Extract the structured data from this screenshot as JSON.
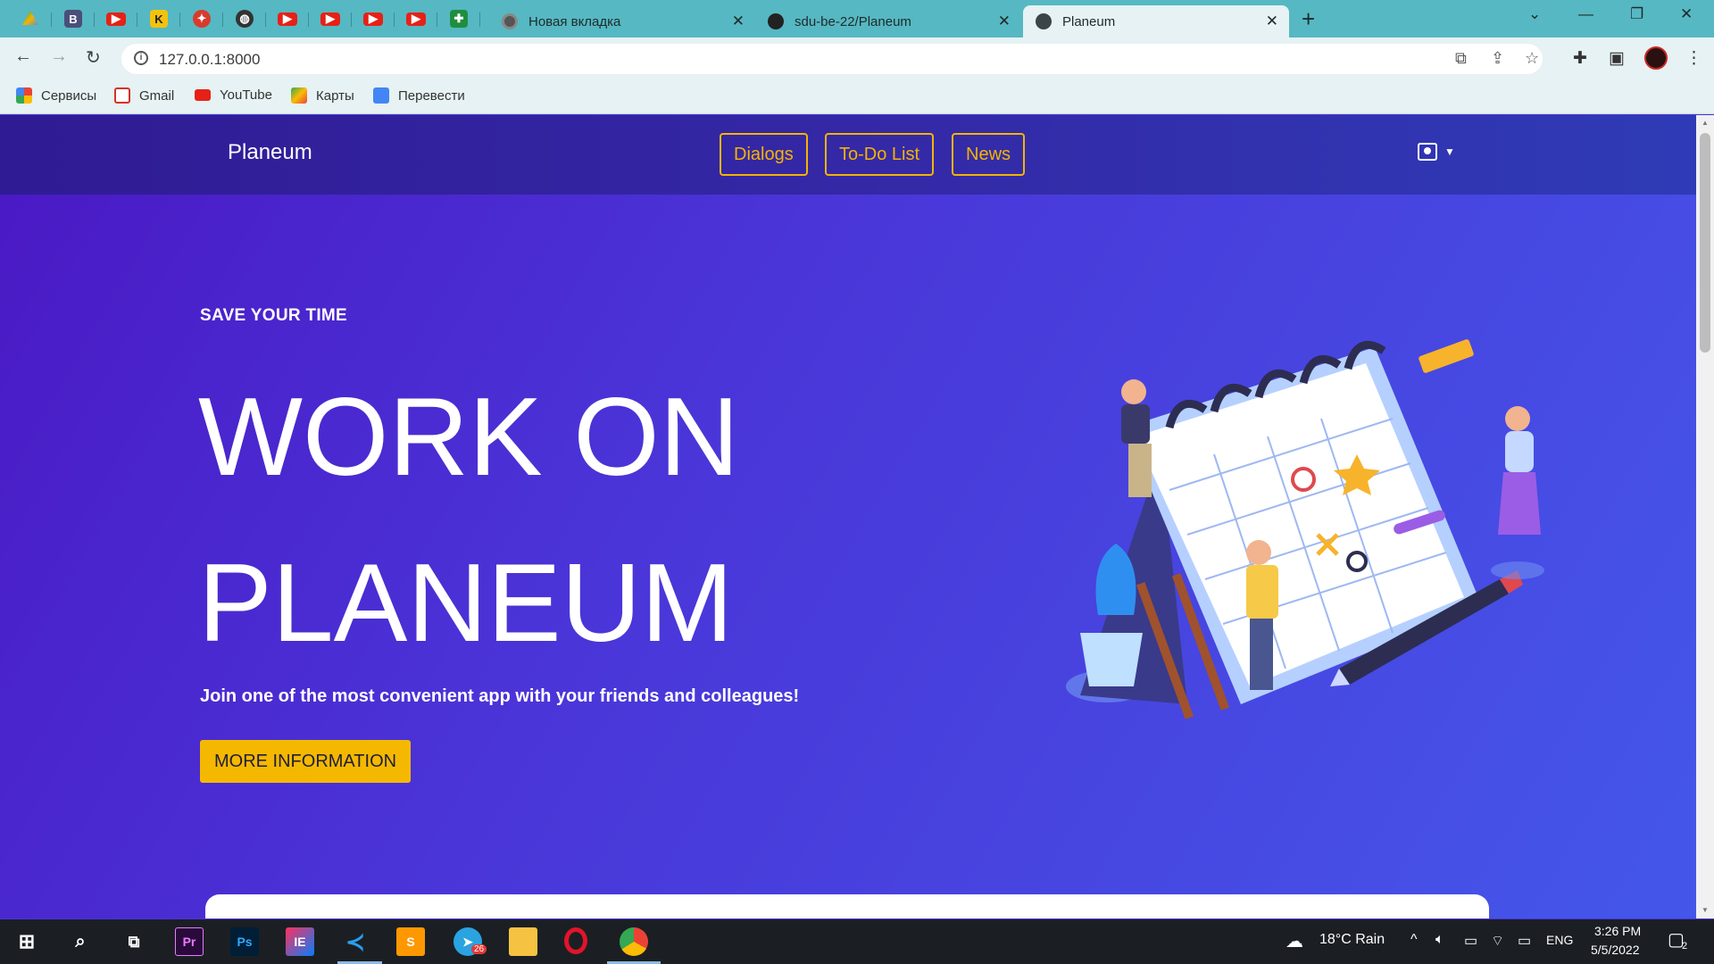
{
  "browser": {
    "tabs": [
      {
        "title": "Новая вкладка"
      },
      {
        "title": "sdu-be-22/Planeum"
      },
      {
        "title": "Planeum"
      }
    ],
    "url": "127.0.0.1:8000",
    "bookmarks": [
      {
        "label": "Сервисы",
        "icon": "apps-grid-icon"
      },
      {
        "label": "Gmail",
        "icon": "gmail-icon"
      },
      {
        "label": "YouTube",
        "icon": "youtube-icon"
      },
      {
        "label": "Карты",
        "icon": "maps-icon"
      },
      {
        "label": "Перевести",
        "icon": "translate-icon"
      }
    ],
    "pinned_letters": {
      "b": "B",
      "k": "K"
    }
  },
  "site": {
    "brand": "Planeum",
    "nav": {
      "dialogs": "Dialogs",
      "todo": "To-Do List",
      "news": "News"
    },
    "eyebrow": "SAVE YOUR TIME",
    "hero_line1": "WORK ON",
    "hero_line2": "PLANEUM",
    "lede": "Join one of the most convenient app with your friends and colleagues!",
    "cta": "MORE INFORMATION",
    "colors": {
      "accent": "#f5b800",
      "nav_bg": "#2f1b93",
      "hero_bg": "#4a35d8"
    }
  },
  "taskbar": {
    "weather": "18°C  Rain",
    "language": "ENG",
    "time": "3:26 PM",
    "date": "5/5/2022",
    "telegram_badge": "26",
    "notifications": "2",
    "app_letters": {
      "premiere": "Pr",
      "photoshop": "Ps",
      "intellij": "IE"
    }
  }
}
